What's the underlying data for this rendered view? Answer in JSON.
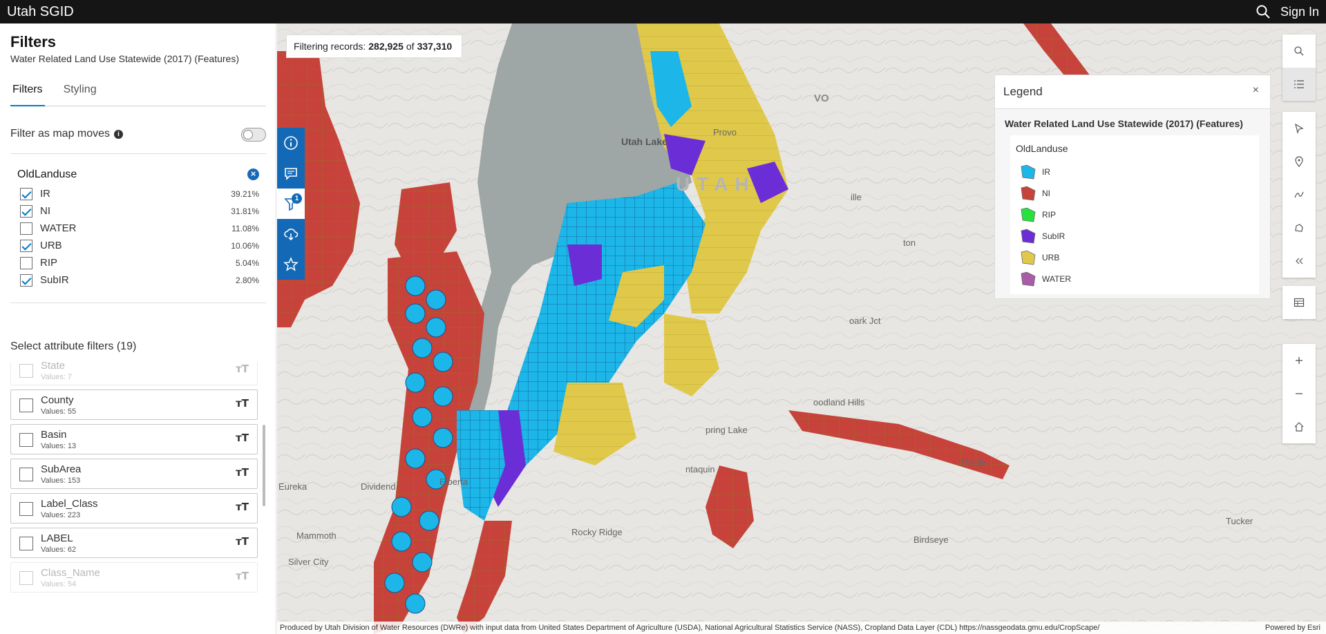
{
  "app": {
    "title": "Utah SGID",
    "sign_in": "Sign In"
  },
  "panel": {
    "title": "Filters",
    "subtitle": "Water Related Land Use Statewide (2017) (Features)",
    "tabs": [
      {
        "label": "Filters",
        "active": true
      },
      {
        "label": "Styling",
        "active": false
      }
    ],
    "filter_as_map_moves": "Filter as map moves",
    "info_glyph": "i",
    "field": {
      "title": "OldLanduse",
      "items": [
        {
          "label": "IR",
          "pct": "39.21%",
          "checked": true
        },
        {
          "label": "NI",
          "pct": "31.81%",
          "checked": true
        },
        {
          "label": "WATER",
          "pct": "11.08%",
          "checked": false
        },
        {
          "label": "URB",
          "pct": "10.06%",
          "checked": true
        },
        {
          "label": "RIP",
          "pct": "5.04%",
          "checked": false
        },
        {
          "label": "SubIR",
          "pct": "2.80%",
          "checked": true
        }
      ]
    },
    "attr_title": "Select attribute filters (19)",
    "attributes": [
      {
        "name": "State",
        "values": "Values: 7"
      },
      {
        "name": "County",
        "values": "Values: 55"
      },
      {
        "name": "Basin",
        "values": "Values: 13"
      },
      {
        "name": "SubArea",
        "values": "Values: 153"
      },
      {
        "name": "Label_Class",
        "values": "Values: 223"
      },
      {
        "name": "LABEL",
        "values": "Values: 62"
      },
      {
        "name": "Class_Name",
        "values": "Values: 54"
      }
    ],
    "type_glyph": "тT"
  },
  "map": {
    "records": {
      "prefix": "Filtering records:",
      "count": "282,925",
      "of": "of",
      "total": "337,310"
    },
    "filter_badge": "1",
    "labels": {
      "lake": "Utah Lake",
      "county": "UTAH",
      "provo": "Provo",
      "oark": "oark Jct",
      "woodland": "oodland Hills",
      "spring_lake": "pring Lake",
      "santaquin": "ntaquin",
      "dividend": "Dividend",
      "thistle": "Thistle",
      "birdseye": "Birdseye",
      "tucker": "Tucker",
      "mammoth": "Mammoth",
      "silver": "Silver City",
      "elberta": "Elberta",
      "rocky": "Rocky Ridge",
      "eureka": "Eureka",
      "ille": "ille",
      "ton": "ton",
      "vo": "VO"
    },
    "attribution": "Produced by Utah Division of Water Resources (DWRe) with input data from United States Department of Agriculture (USDA), National Agricultural Statistics Service (NASS), Cropland Data Layer (CDL) https://nassgeodata.gmu.edu/CropScape/",
    "powered": "Powered by Esri"
  },
  "legend": {
    "title": "Legend",
    "close": "×",
    "layer": "Water Related Land Use Statewide (2017) (Features)",
    "field": "OldLanduse",
    "items": [
      {
        "label": "IR",
        "color": "#1cb6e8"
      },
      {
        "label": "NI",
        "color": "#c8423c"
      },
      {
        "label": "RIP",
        "color": "#27e13c"
      },
      {
        "label": "SubIR",
        "color": "#6b2ed6"
      },
      {
        "label": "URB",
        "color": "#e0c94a"
      },
      {
        "label": "WATER",
        "color": "#a95ca8"
      }
    ]
  },
  "colors": {
    "accent": "#007ac2",
    "toolbar_blue": "#1369b6",
    "lake": "#9ea6a6"
  }
}
